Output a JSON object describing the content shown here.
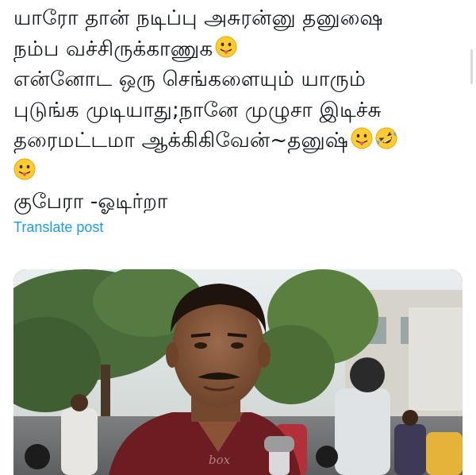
{
  "post": {
    "lines": [
      "யாரோ தான் நடிப்பு அசுரன்னு தனுஷை",
      "நம்ப வச்சிருக்காணுக",
      "என்னோட ஒரு செங்களையும் யாரும்",
      "புடுங்க முடியாது;நானே முழுசா இடிச்சு",
      "தரைமட்டமா ஆக்கிகிவேன்~தனுஷ்",
      "",
      "குபேரா -ஓடிர்றா"
    ],
    "emojis": [
      "face-with-tongue",
      "face-with-tongue",
      "rolling-on-floor-laughing",
      "face-with-tongue"
    ]
  },
  "translate_link": "Translate post",
  "media": {
    "type": "video-frame",
    "watermark": "box"
  },
  "colors": {
    "link": "#1d9bf0",
    "text": "#0f1419"
  }
}
